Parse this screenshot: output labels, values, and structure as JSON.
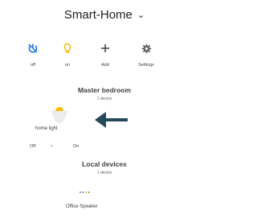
{
  "header": {
    "title": "Smart-Home",
    "caret": "⌄"
  },
  "actions": [
    {
      "name": "off",
      "label": "off"
    },
    {
      "name": "on",
      "label": "on"
    },
    {
      "name": "add",
      "label": "Add"
    },
    {
      "name": "settings",
      "label": "Settings"
    }
  ],
  "rooms": [
    {
      "title": "Master bedroom",
      "subtitle": "1 device",
      "device": {
        "label": "home light"
      },
      "controls": {
        "off": "Off",
        "separator": "•",
        "on": "On"
      }
    },
    {
      "title": "Local devices",
      "subtitle": "1 device",
      "device": {
        "label": "Office Speaker"
      }
    }
  ],
  "colors": {
    "accent_blue": "#1a73e8",
    "icon_grey": "#5f6368",
    "bulb_yellow": "#fbbc04",
    "arrow": "#24485c"
  },
  "icons": [
    "power-off-icon",
    "lightbulb-icon",
    "plus-icon",
    "gear-icon",
    "bulb-device-icon",
    "arrow-left-icon",
    "speaker-dots-icon"
  ]
}
